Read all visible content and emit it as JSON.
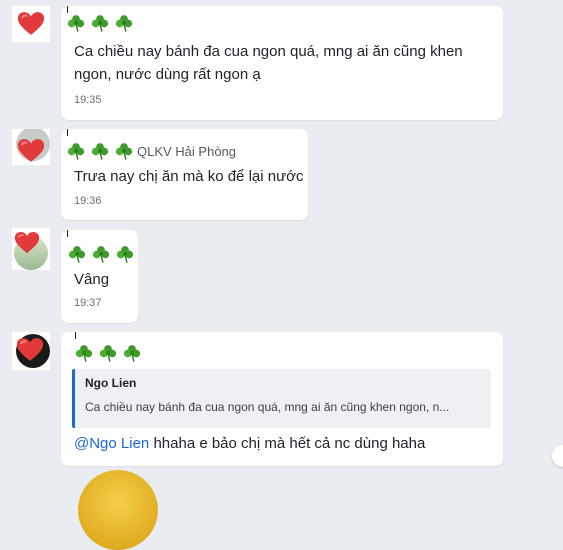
{
  "colors": {
    "background": "#e9ecf1",
    "bubble": "#ffffff",
    "mention": "#1d68d6",
    "quote_border": "#1d68d6",
    "heart": "#e23a3a",
    "clover": "#3f9a2c"
  },
  "messages": [
    {
      "sender": "",
      "reactions": [
        "clover-icon",
        "clover-icon",
        "clover-icon"
      ],
      "lines": [
        "Ca chiều nay bánh đa cua ngon quá, mng ai ăn cũng khen",
        "ngon, nước dùng rất ngon ạ"
      ],
      "time": "19:35"
    },
    {
      "sender": "QLKV Hải Phòng",
      "reactions": [
        "clover-icon",
        "clover-icon",
        "clover-icon"
      ],
      "lines": [
        "Trưa nay chị ăn mà ko để lại nước"
      ],
      "time": "19:36"
    },
    {
      "sender": "",
      "reactions": [
        "clover-icon",
        "clover-icon",
        "clover-icon"
      ],
      "lines": [
        "Vâng"
      ],
      "time": "19:37"
    },
    {
      "sender": "",
      "reactions": [
        "clover-icon",
        "clover-icon",
        "clover-icon"
      ],
      "quote": {
        "name": "Ngo Lien",
        "text": "Ca chiều nay bánh đa cua ngon quá, mng ai ăn cũng khen ngon, n..."
      },
      "mention": "@Ngo Lien",
      "text": " hhaha e bảo chị mà hết cả nc dùng haha"
    }
  ]
}
